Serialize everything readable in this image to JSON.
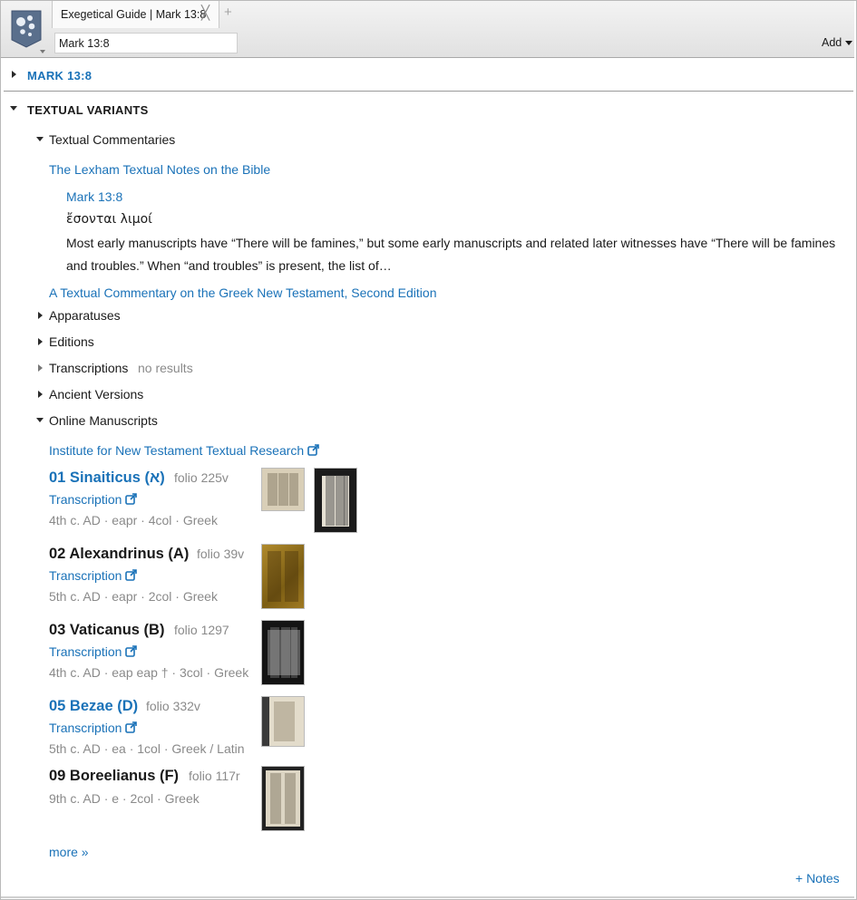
{
  "window": {
    "tab_title": "Exegetical Guide | Mark 13:8",
    "tab_close": "╳",
    "tab_add": "+",
    "reference_value": "Mark 13:8",
    "add_label": "Add"
  },
  "passage": {
    "label": "MARK 13:8"
  },
  "textual_variants": {
    "label": "TEXTUAL VARIANTS",
    "commentaries": {
      "label": "Textual Commentaries",
      "lexham": {
        "title": "The Lexham Textual Notes on the Bible",
        "reference": "Mark 13:8",
        "greek": "ἔσονται λιμοί",
        "excerpt": "Most early manuscripts have “There will be famines,” but some early manuscripts and related later witnesses have “There will be famines and troubles.” When “and troubles” is present, the list of…"
      },
      "metzger": {
        "title": "A Textual Commentary on the Greek New Testament, Second Edition"
      }
    },
    "apparatuses": {
      "label": "Apparatuses"
    },
    "editions": {
      "label": "Editions"
    },
    "transcriptions": {
      "label": "Transcriptions",
      "status": "no results"
    },
    "ancient_versions": {
      "label": "Ancient Versions"
    },
    "online_manuscripts": {
      "label": "Online Manuscripts",
      "institute": "Institute for New Testament Textual Research",
      "transcription_label": "Transcription",
      "manuscripts": [
        {
          "name": "01 Sinaiticus (א)",
          "folio": "folio 225v",
          "meta": "4th c. AD · eapr · 4col · Greek"
        },
        {
          "name": "02 Alexandrinus (A)",
          "folio": "folio 39v",
          "meta": "5th c. AD · eapr · 2col · Greek"
        },
        {
          "name": "03 Vaticanus (B)",
          "folio": "folio 1297",
          "meta": "4th c. AD · eap eap † · 3col · Greek"
        },
        {
          "name": "05 Bezae (D)",
          "folio": "folio 332v",
          "meta": "5th c. AD · ea · 1col · Greek / Latin"
        },
        {
          "name": "09 Boreelianus (F)",
          "folio": "folio 117r",
          "meta": "9th c. AD · e · 2col · Greek"
        }
      ],
      "more_label": "more »"
    }
  },
  "notes_label": "+ Notes",
  "colors": {
    "link": "#1a72b8",
    "muted": "#8a8a8a",
    "text": "#1a1a1a"
  },
  "icons": {
    "logo": "logos-app-icon",
    "external": "external-link-icon"
  }
}
